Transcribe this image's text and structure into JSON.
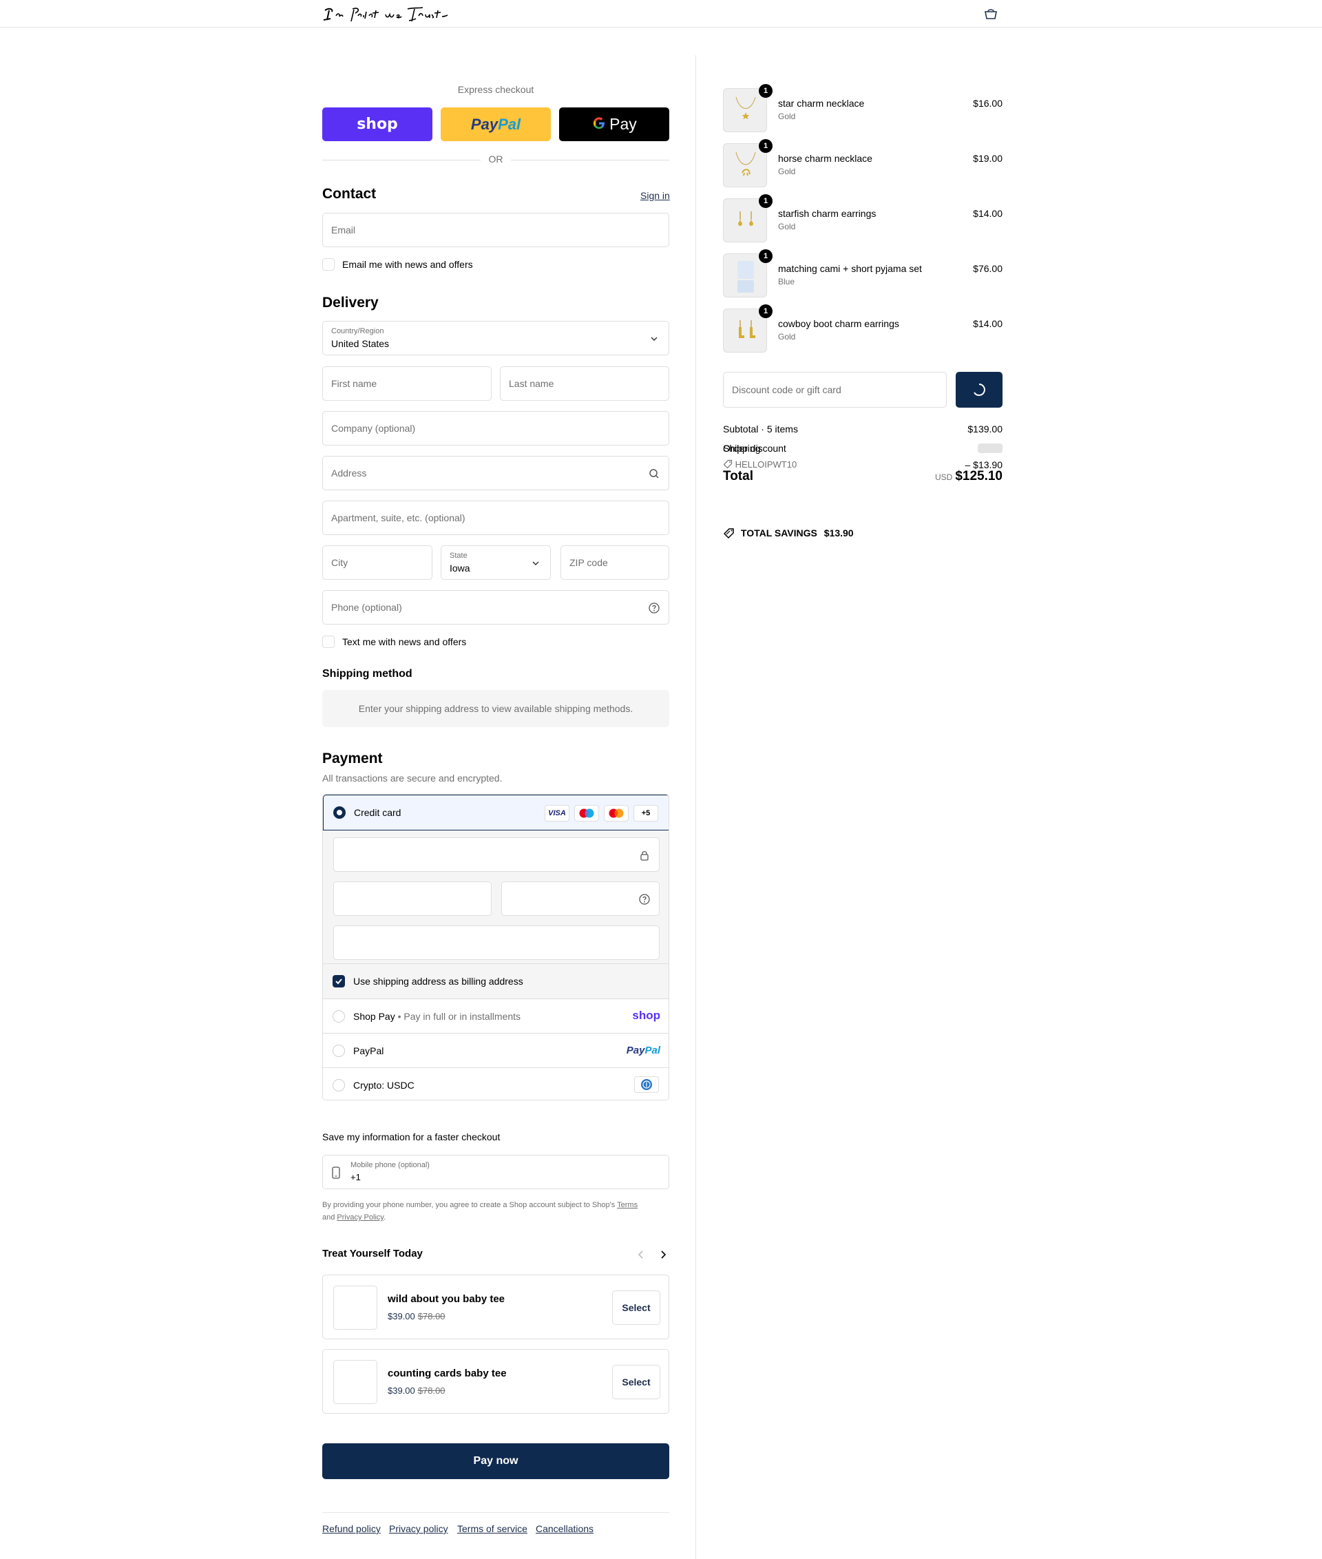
{
  "header": {
    "logo_text": "In Print we Trust"
  },
  "express": {
    "title": "Express checkout",
    "shop_label": "shop",
    "paypal_label_a": "Pay",
    "paypal_label_b": "Pal",
    "gpay_label": "Pay",
    "or_label": "OR"
  },
  "contact": {
    "heading": "Contact",
    "sign_in": "Sign in",
    "email_placeholder": "Email",
    "news_label": "Email me with news and offers"
  },
  "delivery": {
    "heading": "Delivery",
    "country_label": "Country/Region",
    "country_value": "United States",
    "first_name": "First name",
    "last_name": "Last name",
    "company": "Company (optional)",
    "address": "Address",
    "apartment": "Apartment, suite, etc. (optional)",
    "city": "City",
    "state_label": "State",
    "state_value": "Iowa",
    "zip": "ZIP code",
    "phone": "Phone (optional)",
    "text_label": "Text me with news and offers"
  },
  "shipping": {
    "heading": "Shipping method",
    "message": "Enter your shipping address to view available shipping methods."
  },
  "payment": {
    "heading": "Payment",
    "subtitle": "All transactions are secure and encrypted.",
    "credit_card": "Credit card",
    "visa": "VISA",
    "more_cards": "+5",
    "billing_label": "Use shipping address as billing address",
    "shop_pay": "Shop Pay",
    "shop_pay_sub": "Pay in full or in installments",
    "shop_logo": "shop",
    "paypal": "PayPal",
    "paypal_logo_a": "Pay",
    "paypal_logo_b": "Pal",
    "crypto": "Crypto: USDC"
  },
  "save": {
    "heading": "Save my information for a faster checkout",
    "mobile_label": "Mobile phone (optional)",
    "mobile_value": "+1",
    "fine_a": "By providing your phone number, you agree to create a Shop account subject to Shop's ",
    "terms": "Terms",
    "fine_b": "and ",
    "privacy": "Privacy Policy",
    "fine_c": "."
  },
  "upsell": {
    "heading": "Treat Yourself Today",
    "items": [
      {
        "name": "wild about you baby tee",
        "price": "$39.00",
        "old_price": "$78.00",
        "button": "Select"
      },
      {
        "name": "counting cards baby tee",
        "price": "$39.00",
        "old_price": "$78.00",
        "button": "Select"
      }
    ]
  },
  "pay_now": "Pay now",
  "footer": {
    "links": [
      "Refund policy",
      "Privacy policy",
      "Terms of service",
      "Cancellations"
    ]
  },
  "cart": {
    "items": [
      {
        "qty": "1",
        "name": "star charm necklace",
        "variant": "Gold",
        "price": "$16.00"
      },
      {
        "qty": "1",
        "name": "horse charm necklace",
        "variant": "Gold",
        "price": "$19.00"
      },
      {
        "qty": "1",
        "name": "starfish charm earrings",
        "variant": "Gold",
        "price": "$14.00"
      },
      {
        "qty": "1",
        "name": "matching cami + short pyjama set",
        "variant": "Blue",
        "price": "$76.00"
      },
      {
        "qty": "1",
        "name": "cowboy boot charm earrings",
        "variant": "Gold",
        "price": "$14.00"
      }
    ],
    "discount_placeholder": "Discount code or gift card",
    "subtotal_label": "Subtotal · 5 items",
    "subtotal_value": "$139.00",
    "shipping_label": "Shipping",
    "discount_label": "Order discount",
    "discount_code": "HELLOIPWT10",
    "discount_value": "– $13.90",
    "total_label": "Total",
    "currency": "USD",
    "total_value": "$125.10",
    "savings_label": "TOTAL SAVINGS",
    "savings_value": "$13.90"
  },
  "colors": {
    "primary": "#0f2a4f",
    "shop_purple": "#5a31f4",
    "paypal_yellow": "#ffc439"
  }
}
